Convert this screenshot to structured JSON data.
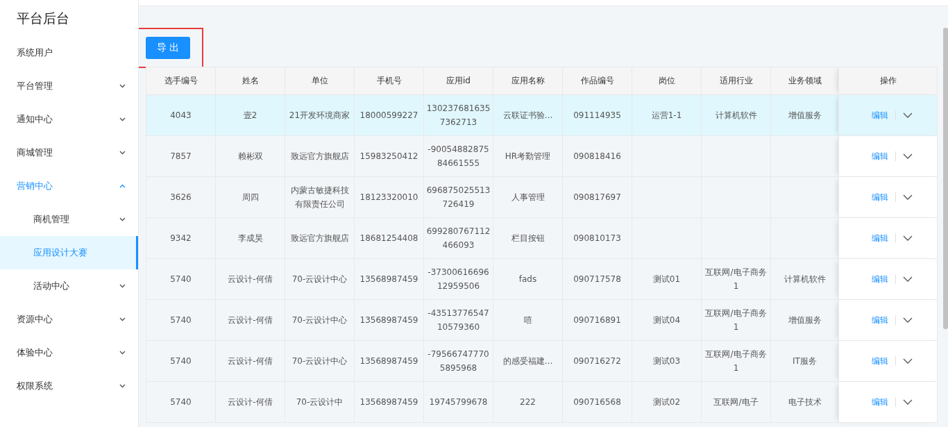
{
  "sidebar": {
    "title": "平台后台",
    "items": [
      {
        "label": "系统用户",
        "kind": "link",
        "selected": false
      },
      {
        "label": "平台管理",
        "kind": "submenu",
        "expanded": false,
        "selected": false
      },
      {
        "label": "通知中心",
        "kind": "submenu",
        "expanded": false,
        "selected": false
      },
      {
        "label": "商城管理",
        "kind": "submenu",
        "expanded": false,
        "selected": false
      },
      {
        "label": "营销中心",
        "kind": "submenu",
        "expanded": true,
        "selected": false,
        "children": [
          {
            "label": "商机管理",
            "kind": "submenu",
            "expanded": false,
            "selected": false
          },
          {
            "label": "应用设计大赛",
            "kind": "link",
            "selected": true
          },
          {
            "label": "活动中心",
            "kind": "submenu",
            "expanded": false,
            "selected": false
          }
        ]
      },
      {
        "label": "资源中心",
        "kind": "submenu",
        "expanded": false,
        "selected": false
      },
      {
        "label": "体验中心",
        "kind": "submenu",
        "expanded": false,
        "selected": false
      },
      {
        "label": "权限系统",
        "kind": "submenu",
        "expanded": false,
        "selected": false
      }
    ]
  },
  "export_button": {
    "label": "导 出",
    "highlighted": true
  },
  "table": {
    "columns": [
      "选手编号",
      "姓名",
      "单位",
      "手机号",
      "应用id",
      "应用名称",
      "作品编号",
      "岗位",
      "适用行业",
      "业务领域",
      "操作"
    ],
    "rows": [
      {
        "selected": true,
        "cells": [
          "4043",
          "壹2",
          "21开发环境商家",
          "18000599227",
          "1302376816357362713",
          "云联证书验…",
          "091114935",
          "运营1-1",
          "计算机软件",
          "增值服务"
        ],
        "action": "编辑"
      },
      {
        "selected": false,
        "cells": [
          "7857",
          "赖彬双",
          "致远官方旗舰店",
          "15983250412",
          "-9005488287584661555",
          "HR考勤管理",
          "090818416",
          "",
          "",
          ""
        ],
        "action": "编辑"
      },
      {
        "selected": false,
        "cells": [
          "3626",
          "周四",
          "内蒙古敏捷科技有限责任公司",
          "18123320010",
          "696875025513726419",
          "人事管理",
          "090817697",
          "",
          "",
          ""
        ],
        "action": "编辑"
      },
      {
        "selected": false,
        "cells": [
          "9342",
          "李成昊",
          "致远官方旗舰店",
          "18681254408",
          "699280767112466093",
          "栏目按钮",
          "090810173",
          "",
          "",
          ""
        ],
        "action": "编辑"
      },
      {
        "selected": false,
        "cells": [
          "5740",
          "云设计-何倩",
          "70-云设计中心",
          "13568987459",
          "-3730061669612959506",
          "fads",
          "090717578",
          "测试01",
          "互联网/电子商务1",
          "计算机软件"
        ],
        "action": "编辑"
      },
      {
        "selected": false,
        "cells": [
          "5740",
          "云设计-何倩",
          "70-云设计中心",
          "13568987459",
          "-4351377654710579360",
          "嘻",
          "090716891",
          "测试04",
          "互联网/电子商务1",
          "增值服务"
        ],
        "action": "编辑"
      },
      {
        "selected": false,
        "cells": [
          "5740",
          "云设计-何倩",
          "70-云设计中心",
          "13568987459",
          "-795667477705895968",
          "的感受福建…",
          "090716272",
          "测试03",
          "互联网/电子商务1",
          "IT服务"
        ],
        "action": "编辑"
      },
      {
        "selected": false,
        "cells": [
          "5740",
          "云设计-何倩",
          "70-云设计中",
          "13568987459",
          "19745799678",
          "222",
          "090716568",
          "测试02",
          "互联网/电子",
          "电子技术"
        ],
        "action": "编辑"
      }
    ]
  }
}
